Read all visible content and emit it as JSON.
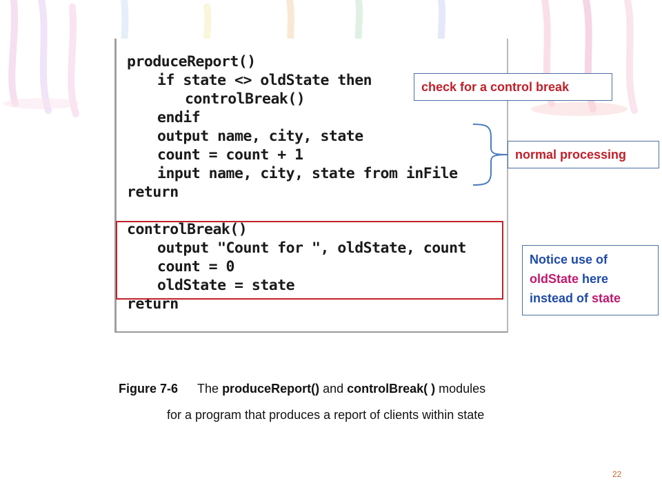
{
  "code": {
    "lines": [
      "produceReport()",
      "if state <> oldState then",
      "controlBreak()",
      "endif",
      "output name, city, state",
      "count = count + 1",
      "input name, city, state from inFile",
      "return",
      "",
      "controlBreak()",
      "output \"Count for \", oldState, count",
      "count = 0",
      "oldState = state",
      "return"
    ]
  },
  "callouts": {
    "control_break": "check for a control break",
    "normal_processing": "normal processing",
    "notice": {
      "line1": "Notice use of",
      "line2_var": "oldState",
      "line2_rest": " here",
      "line3_pre": "instead of ",
      "line3_var": "state"
    }
  },
  "caption": {
    "figure": "Figure 7-6",
    "text1": "The ",
    "bold1": "produceReport()",
    "text2": " and ",
    "bold2": "controlBreak( )",
    "text3": " modules",
    "line2": "for a program that produces a report of clients within state"
  },
  "page_number": "22",
  "colors": {
    "callout_red": "#c0202a",
    "callout_blue": "#1f4aa8",
    "callout_magenta": "#c0186d",
    "highlight_border": "#c0202a",
    "page_number": "#c36a2d"
  }
}
